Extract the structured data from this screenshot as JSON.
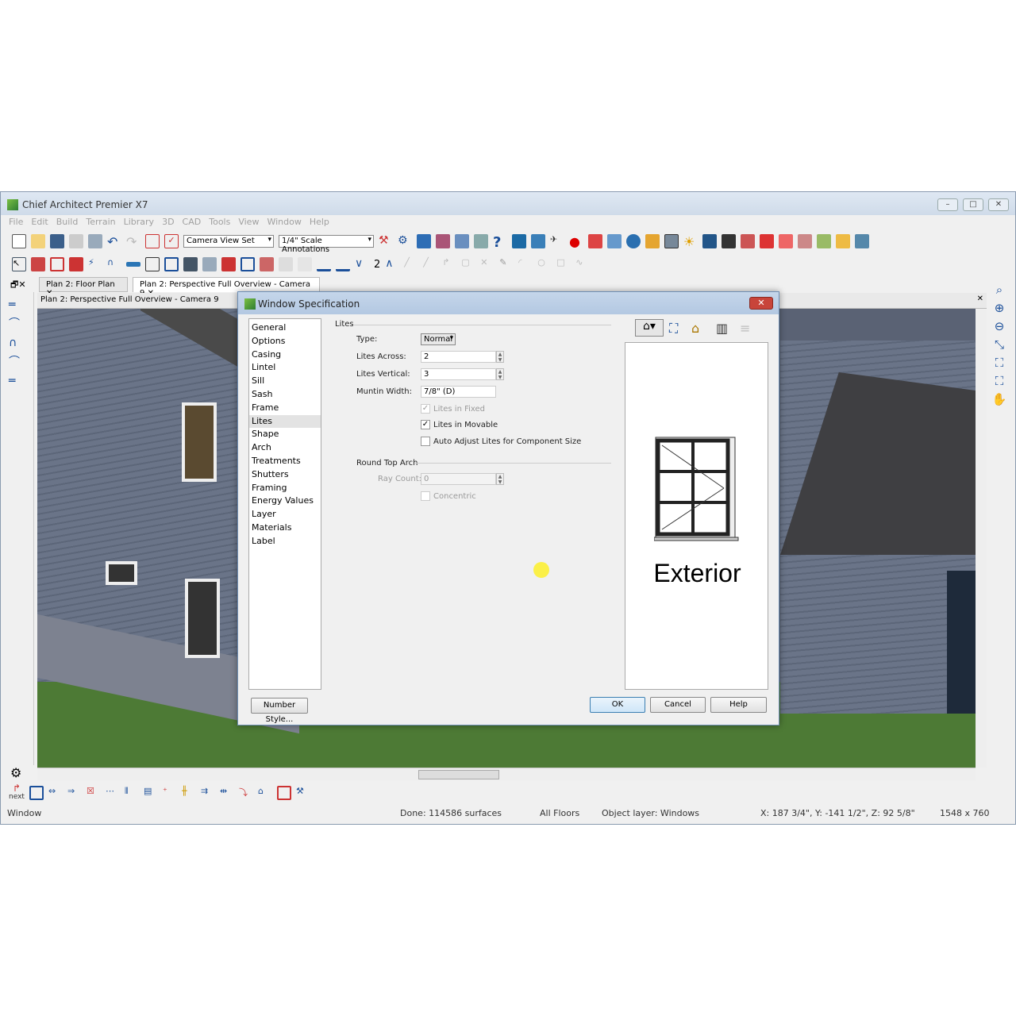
{
  "app": {
    "title": "Chief Architect Premier X7",
    "menu": [
      "File",
      "Edit",
      "Build",
      "Terrain",
      "Library",
      "3D",
      "CAD",
      "Tools",
      "View",
      "Window",
      "Help"
    ]
  },
  "toolbar": {
    "view_set": "Camera View Set",
    "annotation_set": "1/4\" Scale Annotations",
    "floor_number": "2"
  },
  "tabs": [
    {
      "label": "Plan 2: Floor Plan"
    },
    {
      "label": "Plan 2: Perspective Full Overview - Camera 9"
    }
  ],
  "view": {
    "header": "Plan 2: Perspective Full Overview - Camera 9"
  },
  "bottom_toolbar": {
    "next_label": "next"
  },
  "status": {
    "mode": "Window",
    "surfaces": "Done:  114586 surfaces",
    "floors": "All Floors",
    "layer": "Object layer: Windows",
    "coords": "X: 187 3/4\", Y: -141 1/2\", Z: 92 5/8\"",
    "size": "1548 x 760"
  },
  "dialog": {
    "title": "Window Specification",
    "nav": [
      "General",
      "Options",
      "Casing",
      "Lintel",
      "Sill",
      "Sash",
      "Frame",
      "Lites",
      "Shape",
      "Arch",
      "Treatments",
      "Shutters",
      "Framing",
      "Energy Values",
      "Layer",
      "Materials",
      "Label"
    ],
    "selected_nav": "Lites",
    "lites": {
      "section": "Lites",
      "type_label": "Type:",
      "type_value": "Normal",
      "across_label": "Lites Across:",
      "across_value": "2",
      "vertical_label": "Lites Vertical:",
      "vertical_value": "3",
      "muntin_label": "Muntin Width:",
      "muntin_value": "7/8\" (D)",
      "fixed_label": "Lites in Fixed",
      "fixed_checked": true,
      "movable_label": "Lites in Movable",
      "movable_checked": true,
      "auto_label": "Auto Adjust Lites for Component Size",
      "auto_checked": false
    },
    "arch": {
      "section": "Round Top Arch",
      "ray_label": "Ray Count:",
      "ray_value": "0",
      "concentric_label": "Concentric",
      "concentric_checked": false
    },
    "preview_label": "Exterior",
    "buttons": {
      "number_style": "Number Style...",
      "ok": "OK",
      "cancel": "Cancel",
      "help": "Help"
    }
  }
}
